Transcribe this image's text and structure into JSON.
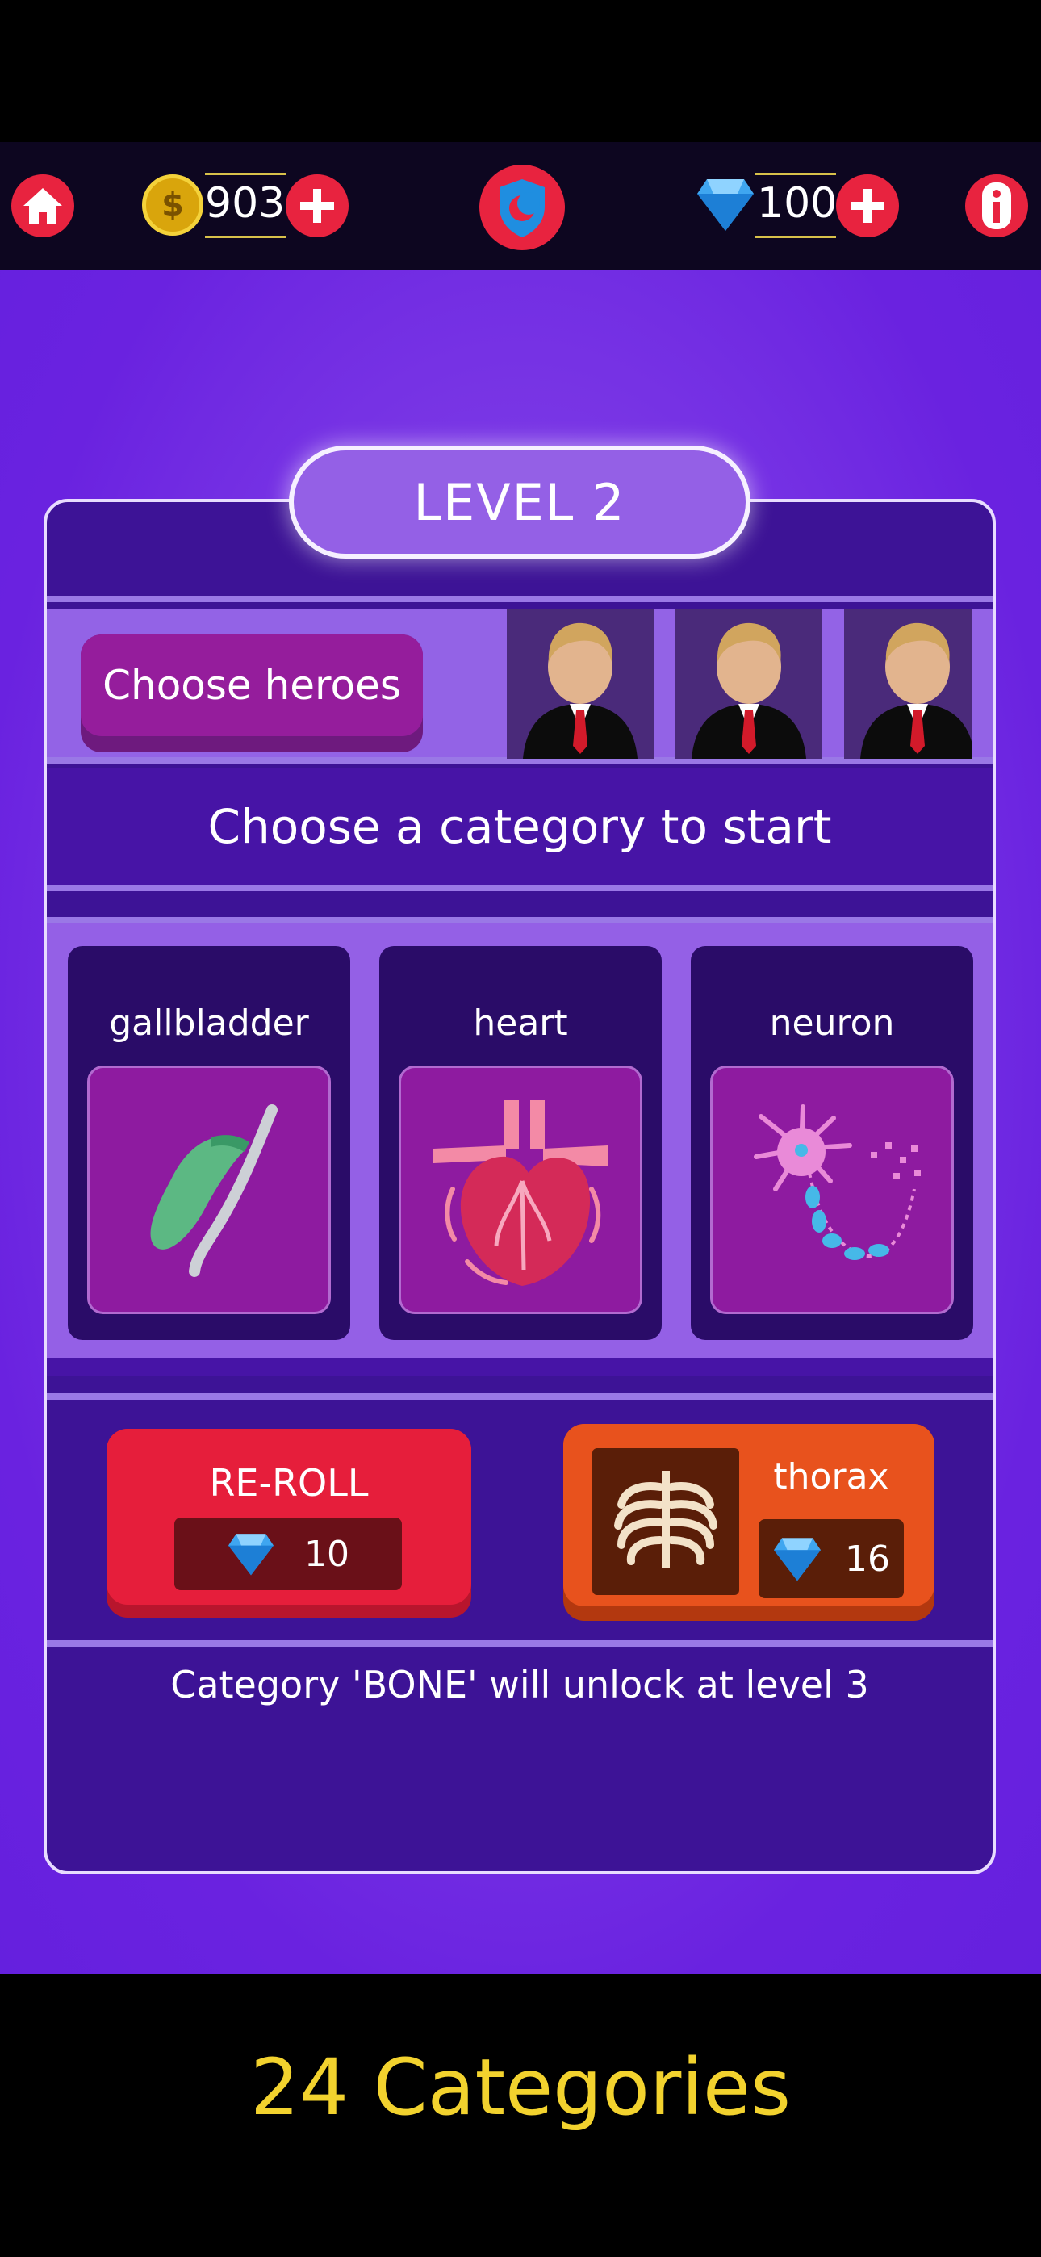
{
  "topbar": {
    "coins": "903",
    "gems": "100",
    "coin_symbol": "$",
    "icons": [
      "home-icon",
      "coin-icon",
      "plus-icon",
      "shield-moon-icon",
      "gem-icon",
      "plus-icon",
      "info-icon"
    ]
  },
  "level": {
    "label": "LEVEL 2"
  },
  "heroes": {
    "button_label": "Choose heroes",
    "count": 3
  },
  "prompt": "Choose a category to start",
  "categories": [
    {
      "name": "gallbladder",
      "icon": "gallbladder-icon"
    },
    {
      "name": "heart",
      "icon": "heart-organ-icon"
    },
    {
      "name": "neuron",
      "icon": "neuron-icon"
    }
  ],
  "reroll": {
    "label": "RE-ROLL",
    "cost": "10"
  },
  "bonus_category": {
    "name": "thorax",
    "cost": "16",
    "icon": "ribcage-icon"
  },
  "unlock_message": "Category 'BONE' will unlock at level 3",
  "footer_caption": "24 Categories",
  "colors": {
    "accent_red": "#e61e3b",
    "panel_bg": "#3d1396",
    "stage_purple": "#7c3ae6",
    "caption_yellow": "#f2d22e",
    "thorax_orange": "#e8521d"
  }
}
